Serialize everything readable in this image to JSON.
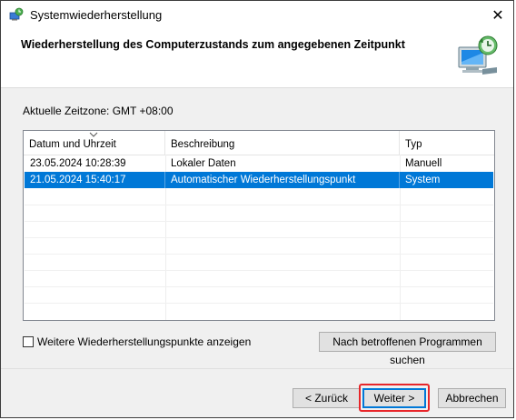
{
  "window": {
    "title": "Systemwiederherstellung",
    "close_glyph": "✕",
    "icons": [
      "restore-icon",
      "close-icon",
      "computer-restore-icon",
      "sort-arrow-icon"
    ]
  },
  "header": {
    "heading": "Wiederherstellung des Computerzustands zum angegebenen Zeitpunkt"
  },
  "timezone_label": "Aktuelle Zeitzone: GMT +08:00",
  "list": {
    "columns": [
      "Datum und Uhrzeit",
      "Beschreibung",
      "Typ"
    ],
    "rows": [
      {
        "date": "23.05.2024 10:28:39",
        "description": "Lokaler Daten",
        "type": "Manuell",
        "selected": false
      },
      {
        "date": "21.05.2024 15:40:17",
        "description": "Automatischer Wiederherstellungspunkt",
        "type": "System",
        "selected": true
      }
    ]
  },
  "more_points": {
    "label": "Weitere Wiederherstellungspunkte anzeigen",
    "checked": false
  },
  "buttons": {
    "affected": "Nach betroffenen Programmen suchen",
    "back": "< Zurück",
    "next": "Weiter >",
    "cancel": "Abbrechen"
  },
  "colors": {
    "selection": "#0078d7",
    "highlight_border": "#e8262a"
  }
}
